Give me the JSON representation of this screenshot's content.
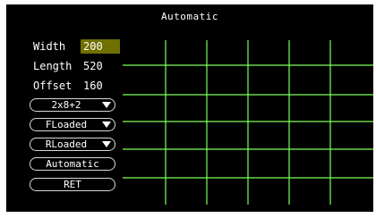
{
  "title": "Automatic",
  "params": [
    {
      "label": "Width",
      "value": "200"
    },
    {
      "label": "Length",
      "value": "520"
    },
    {
      "label": "Offset",
      "value": "160"
    }
  ],
  "dropdowns": [
    {
      "label": "2x8+2"
    },
    {
      "label": "FLoaded"
    },
    {
      "label": "RLoaded"
    }
  ],
  "buttons": {
    "automatic": "Automatic",
    "ret": "RET"
  },
  "colors": {
    "background": "#000000",
    "grid_line": "#7cff5a",
    "highlight": "#707000"
  }
}
